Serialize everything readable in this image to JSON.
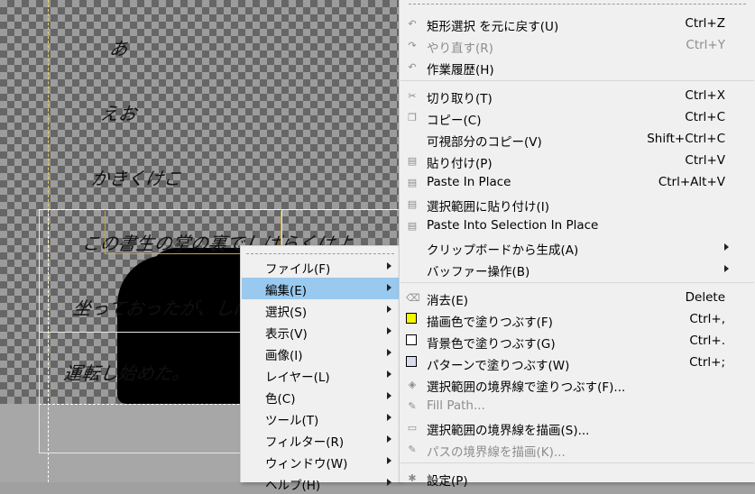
{
  "canvas": {
    "handwriting_lines": [
      "あ",
      "えお",
      "かきくけこ",
      "この書生の掌の裏でしばらくはよ",
      "坐っておったが、しばらくすると非常な",
      "運転し始めた。"
    ]
  },
  "main_menu": {
    "items": [
      {
        "label": "ファイル(F)"
      },
      {
        "label": "編集(E)"
      },
      {
        "label": "選択(S)"
      },
      {
        "label": "表示(V)"
      },
      {
        "label": "画像(I)"
      },
      {
        "label": "レイヤー(L)"
      },
      {
        "label": "色(C)"
      },
      {
        "label": "ツール(T)"
      },
      {
        "label": "フィルター(R)"
      },
      {
        "label": "ウィンドウ(W)"
      },
      {
        "label": "ヘルプ(H)"
      }
    ],
    "active_index": 1
  },
  "edit_menu": {
    "items": [
      {
        "label": "矩形選択 を元に戻す(U)",
        "shortcut": "Ctrl+Z",
        "icon": "undo-icon",
        "icon_char": "↶",
        "disabled": false
      },
      {
        "label": "やり直す(R)",
        "shortcut": "Ctrl+Y",
        "icon": "redo-icon",
        "icon_char": "↷",
        "disabled": true
      },
      {
        "label": "作業履歴(H)",
        "shortcut": "",
        "icon": "history-icon",
        "icon_char": "↶",
        "disabled": false
      },
      {
        "label": "切り取り(T)",
        "shortcut": "Ctrl+X",
        "icon": "cut-icon",
        "icon_char": "✂",
        "disabled": false
      },
      {
        "label": "コピー(C)",
        "shortcut": "Ctrl+C",
        "icon": "copy-icon",
        "icon_char": "❐",
        "disabled": false
      },
      {
        "label": "可視部分のコピー(V)",
        "shortcut": "Shift+Ctrl+C",
        "icon": "",
        "icon_char": "",
        "disabled": false
      },
      {
        "label": "貼り付け(P)",
        "shortcut": "Ctrl+V",
        "icon": "paste-icon",
        "icon_char": "▤",
        "disabled": false
      },
      {
        "label": "Paste In Place",
        "shortcut": "Ctrl+Alt+V",
        "icon": "paste-in-place-icon",
        "icon_char": "▤",
        "disabled": false
      },
      {
        "label": "選択範囲に貼り付け(I)",
        "shortcut": "",
        "icon": "paste-into-icon",
        "icon_char": "▤",
        "disabled": false
      },
      {
        "label": "Paste Into Selection In Place",
        "shortcut": "",
        "icon": "paste-into-in-place-icon",
        "icon_char": "▤",
        "disabled": false
      },
      {
        "label": "クリップボードから生成(A)",
        "shortcut": "",
        "icon": "",
        "icon_char": "",
        "disabled": false,
        "submenu": true
      },
      {
        "label": "バッファー操作(B)",
        "shortcut": "",
        "icon": "",
        "icon_char": "",
        "disabled": false,
        "submenu": true
      },
      {
        "label": "消去(E)",
        "shortcut": "Delete",
        "icon": "clear-icon",
        "icon_char": "⌫",
        "disabled": false
      },
      {
        "label": "描画色で塗りつぶす(F)",
        "shortcut": "Ctrl+,",
        "icon": "fg-fill-swatch",
        "swatch": "#f5f500",
        "disabled": false
      },
      {
        "label": "背景色で塗りつぶす(G)",
        "shortcut": "Ctrl+.",
        "icon": "bg-fill-swatch",
        "swatch": "#ffffff",
        "disabled": false
      },
      {
        "label": "パターンで塗りつぶす(W)",
        "shortcut": "Ctrl+;",
        "icon": "pattern-fill-swatch",
        "swatch": "#d9dcec",
        "disabled": false
      },
      {
        "label": "選択範囲の境界線で塗りつぶす(F)...",
        "shortcut": "",
        "icon": "fill-selection-outline-icon",
        "icon_char": "◈",
        "disabled": false
      },
      {
        "label": "Fill Path...",
        "shortcut": "",
        "icon": "fill-path-icon",
        "icon_char": "✎",
        "disabled": true
      },
      {
        "label": "選択範囲の境界線を描画(S)...",
        "shortcut": "",
        "icon": "stroke-selection-icon",
        "icon_char": "▭",
        "disabled": false
      },
      {
        "label": "パスの境界線を描画(K)...",
        "shortcut": "",
        "icon": "stroke-path-icon",
        "icon_char": "✎",
        "disabled": true
      },
      {
        "label": "設定(P)",
        "shortcut": "",
        "icon": "preferences-icon",
        "icon_char": "✱",
        "disabled": false
      }
    ]
  }
}
